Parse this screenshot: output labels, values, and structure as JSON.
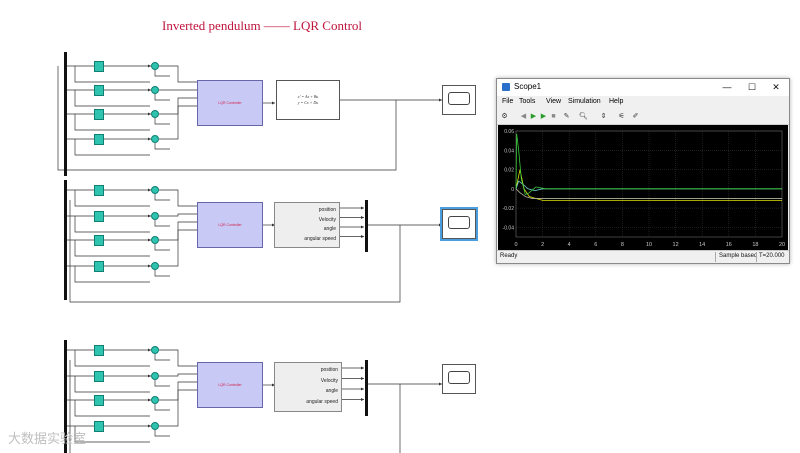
{
  "page_title": "Inverted pendulum —— LQR Control",
  "blocks": {
    "lqr_label": "LQR Controller",
    "state_space": {
      "eq1": "x' = Ax + Bu",
      "eq2": "y = Cx + Du"
    },
    "plant_ports": [
      "position",
      "Velocity",
      "angle",
      "angular speed"
    ]
  },
  "scope_window": {
    "title": "Scope1",
    "controls": {
      "minimize": "—",
      "maximize": "☐",
      "close": "✕"
    },
    "menu": [
      "File",
      "Tools",
      "View",
      "Simulation",
      "Help"
    ],
    "status_left": "Ready",
    "status_mode": "Sample based",
    "status_time": "T=20.000"
  },
  "watermark": "大数据实验室",
  "colors": {
    "title": "#c0143c",
    "gain_block": "#2ec4b0",
    "lqr_block": "#c9c9f5",
    "plot_bg": "#000000",
    "trace_yellow": "#e0e000",
    "trace_cyan": "#6fd3d3",
    "trace_green": "#38c838",
    "grid": "#3a3a3a"
  },
  "chart_data": {
    "type": "line",
    "x_ticks": [
      "0",
      "2",
      "4",
      "6",
      "8",
      "10",
      "12",
      "14",
      "16",
      "18",
      "20"
    ],
    "y_ticks": [
      "0.06",
      "0.04",
      "0.02",
      "0",
      "-0.02",
      "-0.04"
    ],
    "xlim": [
      0,
      20
    ],
    "ylim": [
      -0.05,
      0.06
    ],
    "grid": true,
    "series": [
      {
        "color": "#e0e000",
        "x": [
          0,
          0.3,
          0.6,
          1.0,
          1.5,
          2,
          3,
          20
        ],
        "y": [
          0.0,
          0.02,
          0.0,
          -0.008,
          -0.01,
          -0.012,
          -0.012,
          -0.012
        ]
      },
      {
        "color": "#6fd3d3",
        "x": [
          0,
          0.2,
          0.5,
          0.9,
          1.4,
          2,
          3,
          20
        ],
        "y": [
          0.0,
          0.008,
          0.005,
          0.0,
          -0.002,
          0.0,
          0.0,
          0.0
        ]
      },
      {
        "color": "#38c838",
        "x": [
          0,
          0.05,
          0.2,
          0.4,
          0.7,
          1.0,
          1.5,
          2.2,
          3,
          20
        ],
        "y": [
          0.0,
          0.057,
          0.04,
          0.01,
          -0.006,
          -0.004,
          0.002,
          0.0,
          0.0,
          0.0
        ]
      },
      {
        "color": "#b8b89a",
        "x": [
          0,
          0.3,
          0.7,
          1.2,
          2,
          20
        ],
        "y": [
          0.0,
          -0.004,
          -0.008,
          -0.01,
          -0.01,
          -0.01
        ]
      }
    ]
  }
}
